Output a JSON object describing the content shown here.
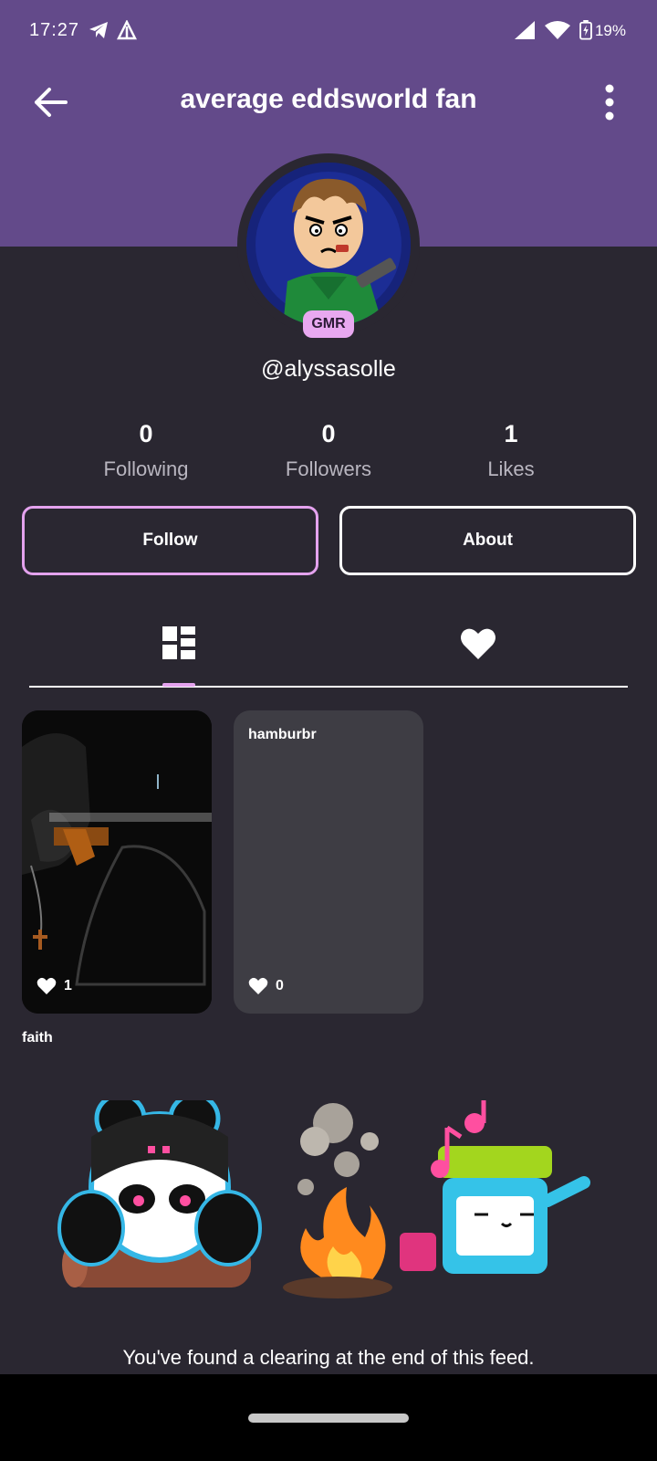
{
  "status_bar": {
    "time": "17:27",
    "battery": "19%"
  },
  "header": {
    "title": "average eddsworld fan"
  },
  "profile": {
    "badge": "GMR",
    "handle": "@alyssasolle"
  },
  "stats": [
    {
      "value": "0",
      "label": "Following"
    },
    {
      "value": "0",
      "label": "Followers"
    },
    {
      "value": "1",
      "label": "Likes"
    }
  ],
  "buttons": {
    "follow": "Follow",
    "about": "About"
  },
  "tabs": [
    {
      "icon": "grid-layout-icon",
      "active": true
    },
    {
      "icon": "heart-icon",
      "active": false
    }
  ],
  "posts": [
    {
      "title": "faith",
      "likes": "1"
    },
    {
      "title": "hamburbr",
      "likes": "0"
    }
  ],
  "feed_end": {
    "message": "You've found a clearing at the end of this feed."
  },
  "colors": {
    "header_bg": "#634a8a",
    "page_bg": "#2a2731",
    "accent": "#e4a2ee",
    "card_bg": "#3e3d44"
  }
}
